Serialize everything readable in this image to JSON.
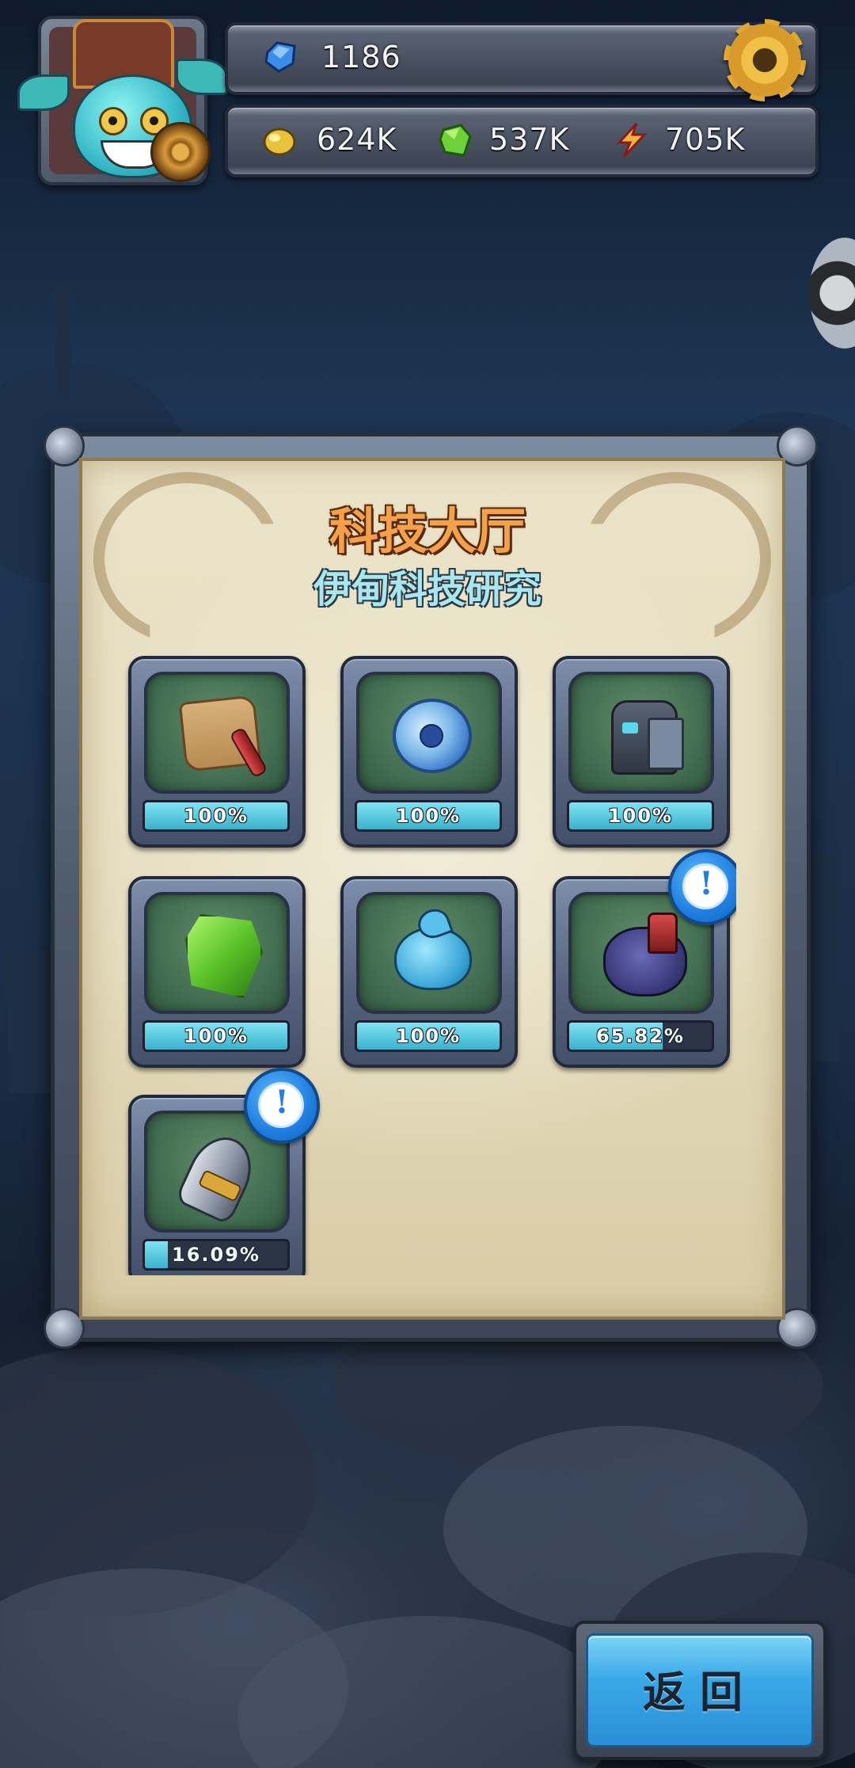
{
  "hud": {
    "gems": "1186",
    "resources": [
      {
        "icon": "gold-ore-icon",
        "value": "624K"
      },
      {
        "icon": "green-crystal-icon",
        "value": "537K"
      },
      {
        "icon": "energy-bolt-icon",
        "value": "705K"
      }
    ],
    "settings_icon": "gear-icon"
  },
  "panel": {
    "title": "科技大厅",
    "subtitle": "伊甸科技研究"
  },
  "techs": [
    {
      "icon": "map-scroll-icon",
      "progress": 1.0,
      "label": "100%",
      "alert": false
    },
    {
      "icon": "blue-orb-icon",
      "progress": 1.0,
      "label": "100%",
      "alert": false
    },
    {
      "icon": "robot-icon",
      "progress": 1.0,
      "label": "100%",
      "alert": false
    },
    {
      "icon": "green-crystal-icon",
      "progress": 1.0,
      "label": "100%",
      "alert": false
    },
    {
      "icon": "blue-slime-icon",
      "progress": 1.0,
      "label": "100%",
      "alert": false
    },
    {
      "icon": "purple-beast-icon",
      "progress": 0.6582,
      "label": "65.82%",
      "alert": true
    },
    {
      "icon": "rocket-ship-icon",
      "progress": 0.1609,
      "label": "16.09%",
      "alert": true
    }
  ],
  "back_button": {
    "label": "返回"
  },
  "colors": {
    "title": "#f3a24a",
    "subtitle": "#a9e7ef",
    "progress_fill": "#3ab2cc",
    "badge": "#1f7ee0",
    "button": "#3aa8e8"
  }
}
